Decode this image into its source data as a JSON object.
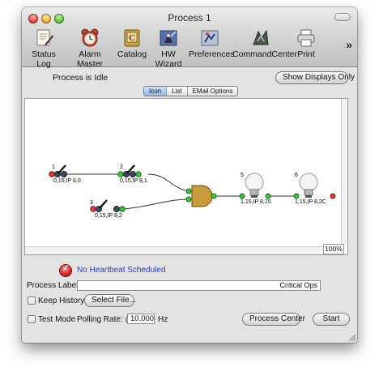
{
  "window": {
    "title": "Process 1"
  },
  "toolbar": {
    "items": [
      {
        "label": "Status Log",
        "icon": "status-log-icon"
      },
      {
        "label": "Alarm Master",
        "icon": "alarm-clock-icon"
      },
      {
        "label": "Catalog",
        "icon": "catalog-icon"
      },
      {
        "label": "HW Wizard",
        "icon": "wizard-icon"
      },
      {
        "label": "Preferences",
        "icon": "preferences-icon"
      },
      {
        "label": "CommandCenter",
        "icon": "command-center-icon"
      },
      {
        "label": "Print",
        "icon": "printer-icon"
      }
    ],
    "overflow": "»"
  },
  "status": {
    "text": "Process is Idle"
  },
  "show_displays_button": "Show Displays Only",
  "view_tabs": {
    "icon": "Icon",
    "list": "List",
    "email": "EMail Options",
    "selected": "Icon"
  },
  "diagram": {
    "switches": [
      {
        "number": "1",
        "label": "0,15,IP 8,0"
      },
      {
        "number": "2",
        "label": "0,15,IP 8,1"
      },
      {
        "number": "3",
        "label": "0,15,IP 8,2"
      }
    ],
    "lamps": [
      {
        "number": "5",
        "label": "1,15,IP 8,15"
      },
      {
        "number": "6",
        "label": "1,15,IP 8,2C"
      }
    ],
    "zoom": "100%"
  },
  "heartbeat": {
    "text": "No Heartbeat Scheduled"
  },
  "process_label": {
    "label": "Process Label:",
    "value": "Critical Ops"
  },
  "keep_history": {
    "label": "Keep History",
    "checked": false
  },
  "select_file_button": "Select File...",
  "test_mode": {
    "label": "Test Mode",
    "checked": false
  },
  "polling": {
    "label": "Polling Rate: @",
    "value": "10.000",
    "unit": "Hz"
  },
  "process_center_button": "Process Center",
  "start_button": "Start",
  "colors": {
    "led_green": "#3cc43c",
    "led_red": "#e03a3a",
    "gate_fill": "#c99a3a",
    "link_blue": "#2a3fb8"
  }
}
